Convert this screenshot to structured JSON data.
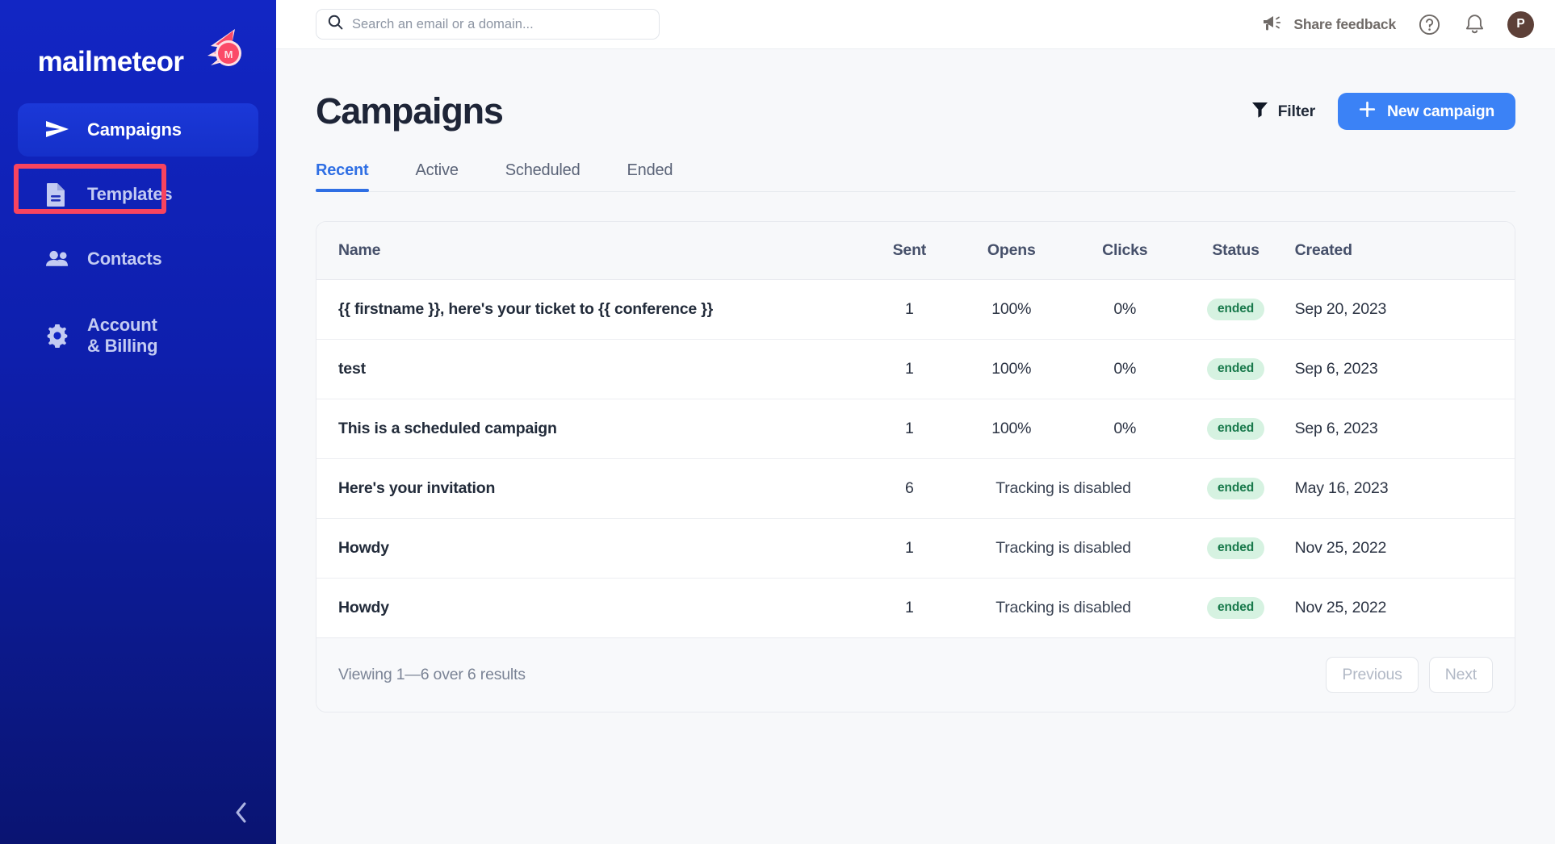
{
  "sidebar": {
    "logo_text": "mailmeteor",
    "items": [
      {
        "label": "Campaigns",
        "icon": "send-icon",
        "active": true
      },
      {
        "label": "Templates",
        "icon": "document-icon",
        "active": false
      },
      {
        "label": "Contacts",
        "icon": "people-icon",
        "active": false
      },
      {
        "label": "Account\n& Billing",
        "icon": "gear-icon",
        "active": false
      }
    ],
    "collapse_icon": "chevron-left-icon",
    "highlight_color": "#f8445f",
    "highlighted_item": "Templates"
  },
  "topbar": {
    "search": {
      "placeholder": "Search an email or a domain...",
      "value": "",
      "icon": "search-icon"
    },
    "feedback_label": "Share feedback",
    "feedback_icon": "megaphone-icon",
    "help_icon": "question-circle-icon",
    "notifications_icon": "bell-icon",
    "avatar_initial": "P",
    "avatar_color": "#5d4038"
  },
  "page": {
    "title": "Campaigns",
    "filter_label": "Filter",
    "filter_icon": "funnel-icon",
    "new_campaign_label": "New campaign",
    "new_campaign_icon": "plus-icon",
    "accent_color": "#3b82f6"
  },
  "tabs": [
    {
      "label": "Recent",
      "active": true
    },
    {
      "label": "Active",
      "active": false
    },
    {
      "label": "Scheduled",
      "active": false
    },
    {
      "label": "Ended",
      "active": false
    }
  ],
  "table": {
    "columns": [
      "Name",
      "Sent",
      "Opens",
      "Clicks",
      "Status",
      "Created"
    ],
    "rows": [
      {
        "name": "{{ firstname }}, here's your ticket to {{ conference }}",
        "sent": "1",
        "opens": "100%",
        "clicks": "0%",
        "status": "ended",
        "created": "Sep 20, 2023"
      },
      {
        "name": "test",
        "sent": "1",
        "opens": "100%",
        "clicks": "0%",
        "status": "ended",
        "created": "Sep 6, 2023"
      },
      {
        "name": "This is a scheduled campaign",
        "sent": "1",
        "opens": "100%",
        "clicks": "0%",
        "status": "ended",
        "created": "Sep 6, 2023"
      },
      {
        "name": "Here's your invitation",
        "sent": "6",
        "opens": "Tracking is disabled",
        "clicks": "",
        "status": "ended",
        "created": "May 16, 2023"
      },
      {
        "name": "Howdy",
        "sent": "1",
        "opens": "Tracking is disabled",
        "clicks": "",
        "status": "ended",
        "created": "Nov 25, 2022"
      },
      {
        "name": "Howdy",
        "sent": "1",
        "opens": "Tracking is disabled",
        "clicks": "",
        "status": "ended",
        "created": "Nov 25, 2022"
      }
    ],
    "status_badge_bg": "#d6f2e1",
    "status_badge_color": "#18794b"
  },
  "footer": {
    "summary": "Viewing 1—6 over 6 results",
    "previous_label": "Previous",
    "next_label": "Next"
  }
}
